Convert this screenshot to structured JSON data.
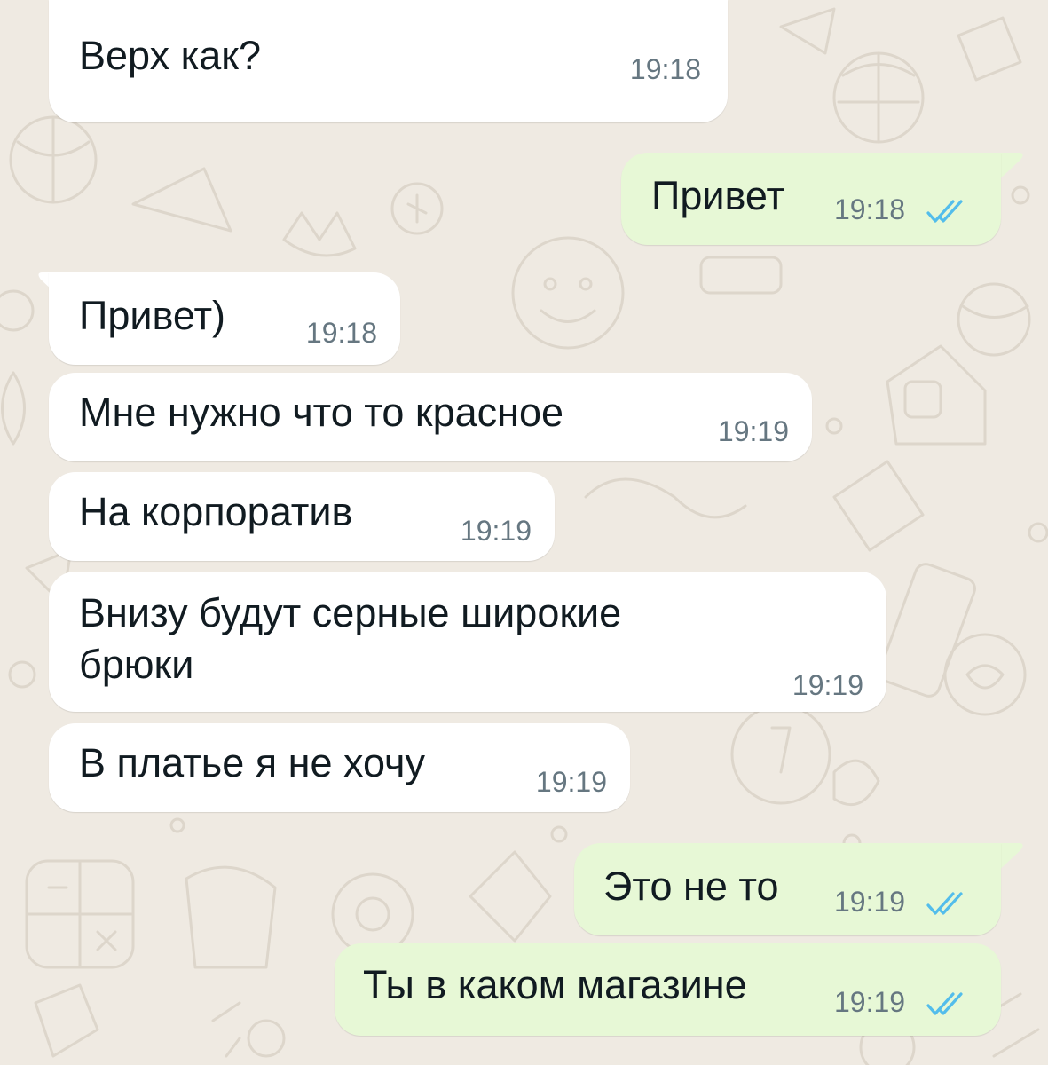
{
  "theme": {
    "wallpaper_color": "#efeae2",
    "incoming_bubble_color": "#ffffff",
    "outgoing_bubble_color": "#e7f8d6",
    "read_tick_color": "#53bdeb"
  },
  "messages": [
    {
      "direction": "in",
      "text": "Верх как?",
      "time": "19:18"
    },
    {
      "direction": "out",
      "text": "Привет",
      "time": "19:18",
      "status": "read-ticks-icon"
    },
    {
      "direction": "in",
      "text": "Привет)",
      "time": "19:18"
    },
    {
      "direction": "in",
      "text": "Мне нужно что то красное",
      "time": "19:19"
    },
    {
      "direction": "in",
      "text": "На корпоратив",
      "time": "19:19"
    },
    {
      "direction": "in",
      "text": "Внизу будут серные широкие",
      "text_line2": "брюки",
      "time": "19:19"
    },
    {
      "direction": "in",
      "text": "В платье я не хочу",
      "time": "19:19"
    },
    {
      "direction": "out",
      "text": "Это не то",
      "time": "19:19",
      "status": "read-ticks-icon"
    },
    {
      "direction": "out",
      "text": "Ты в каком магазине",
      "time": "19:19",
      "status": "read-ticks-icon"
    }
  ]
}
